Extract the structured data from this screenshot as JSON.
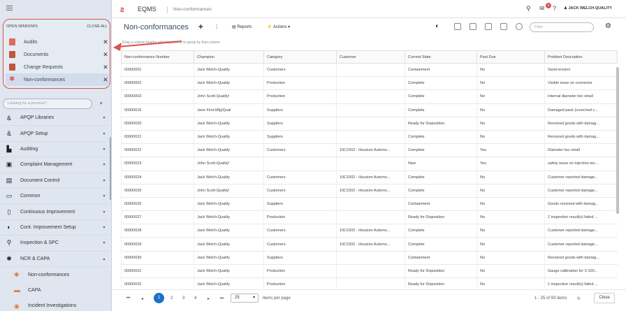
{
  "sidebar": {
    "open_windows": {
      "title": "OPEN WINDOWS",
      "close_all": "CLOSE ALL",
      "items": [
        {
          "label": "Audits",
          "icon": "audit-icon",
          "color": "#e06b5b",
          "active": false
        },
        {
          "label": "Documents",
          "icon": "document-icon",
          "color": "#c0563b",
          "active": false
        },
        {
          "label": "Change Requests",
          "icon": "change-request-icon",
          "color": "#c0563b",
          "active": false
        },
        {
          "label": "Non-conformances",
          "icon": "nonconformance-icon",
          "color": "#e05b5b",
          "active": true
        }
      ]
    },
    "lookup_placeholder": "Looking for a process?",
    "nav": [
      {
        "label": "APQP Libraries",
        "icon": "&"
      },
      {
        "label": "APQP Setup",
        "icon": "&"
      },
      {
        "label": "Auditing",
        "icon": "▙"
      },
      {
        "label": "Complaint Management",
        "icon": "▣"
      },
      {
        "label": "Document Control",
        "icon": "▤"
      },
      {
        "label": "Common",
        "icon": "▭"
      },
      {
        "label": "Continuous Improvement",
        "icon": "▯"
      },
      {
        "label": "Cont. Improvement Setup",
        "icon": "◐"
      },
      {
        "label": "Inspection & SPC",
        "icon": "⚲"
      },
      {
        "label": "NCR & CAPA",
        "icon": "✱"
      }
    ],
    "sub_items": [
      {
        "label": "Non-conformances",
        "icon": "✱"
      },
      {
        "label": "CAPA",
        "icon": "▬"
      },
      {
        "label": "Incident Investigations",
        "icon": "◉"
      }
    ]
  },
  "topbar": {
    "app_title": "EQMS",
    "breadcrumb": "Non-conformances",
    "notification_count": "3",
    "user": "JACK WELCH-QUALITY"
  },
  "toolbar": {
    "page_title": "Non-conformances",
    "reports_label": "Reports",
    "actions_label": "Actions",
    "filter_placeholder": "Filter"
  },
  "grid": {
    "group_hint": "Drag a column header and drop it here to group by that column.",
    "columns": [
      "Non-conformance Number",
      "Champion",
      "Category",
      "Customer",
      "Current State",
      "Past Due",
      "Problem Description"
    ],
    "rows": [
      [
        "00000001",
        "Jack Welch-Quality",
        "Customers",
        "",
        "Containment",
        "No",
        "Sand erosion"
      ],
      [
        "00000002",
        "Jack Welch-Quality",
        "Production",
        "",
        "Complete",
        "No",
        "Visible issue on connector"
      ],
      [
        "00000003",
        "John Scott-Quality!",
        "Production",
        "",
        "Complete",
        "No",
        "Internal diameter too small"
      ],
      [
        "00000016",
        "Jane First-Mfg/Qual",
        "Suppliers",
        "",
        "Complete",
        "No",
        "Damaged pack (crunched c..."
      ],
      [
        "00000020",
        "Jack Welch-Quality",
        "Suppliers",
        "",
        "Ready for Disposition",
        "No",
        "Received goods with damag..."
      ],
      [
        "00000021",
        "Jack Welch-Quality",
        "Suppliers",
        "",
        "Complete",
        "No",
        "Received goods with damag..."
      ],
      [
        "00000022",
        "Jack Welch-Quality",
        "Customers",
        "10C1002 - Houston Automo...",
        "Complete",
        "Yes",
        "Diameter too small"
      ],
      [
        "00000023",
        "John Scott-Quality!",
        "",
        "",
        "New",
        "Yes",
        "safety issue on Injection wo..."
      ],
      [
        "00000024",
        "Jack Welch-Quality",
        "Customers",
        "10C1002 - Houston Automo...",
        "Complete",
        "No",
        "Customer reported damage..."
      ],
      [
        "00000025",
        "John Scott-Quality!",
        "Customers",
        "10C1002 - Houston Automo...",
        "Complete",
        "No",
        "Customer reported damage..."
      ],
      [
        "00000026",
        "Jack Welch-Quality",
        "Suppliers",
        "",
        "Containment",
        "No",
        "Goods received with damag..."
      ],
      [
        "00000027",
        "Jack Welch-Quality",
        "Production",
        "",
        "Ready for Disposition",
        "No",
        "2 inspection result(s) failed ..."
      ],
      [
        "00000028",
        "Jack Welch-Quality",
        "Customers",
        "10C1002 - Houston Automo...",
        "Complete",
        "No",
        "Customer reported damage..."
      ],
      [
        "00000029",
        "Jack Welch-Quality",
        "Customers",
        "10C1002 - Houston Automo...",
        "Complete",
        "No",
        "Customer reported damage..."
      ],
      [
        "00000030",
        "Jack Welch-Quality",
        "Suppliers",
        "",
        "Containment",
        "No",
        "Received goods with damag..."
      ],
      [
        "00000031",
        "Jack Welch-Quality",
        "Production",
        "",
        "Ready for Disposition",
        "No",
        "Gauge calibration for 3-100..."
      ],
      [
        "00000032",
        "Jack Welch-Quality",
        "Production",
        "",
        "Ready for Disposition",
        "No",
        "1 inspection result(s) failed ..."
      ]
    ]
  },
  "pager": {
    "pages": [
      "1",
      "2",
      "3",
      "4"
    ],
    "current": "1",
    "page_size": "25",
    "per_page_label": "items per page",
    "summary": "1 - 25 of 93 items",
    "close_label": "Close"
  },
  "colors": {
    "accent": "#1f6fc9",
    "highlight": "#d9534f",
    "sidebar_bg": "#dfe6ef"
  }
}
